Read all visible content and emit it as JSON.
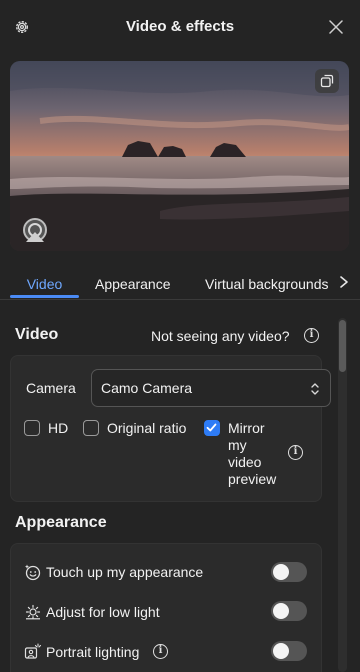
{
  "window": {
    "title": "Video & effects"
  },
  "preview": {
    "popout_icon": "popout-icon",
    "camera_badge": "camo-badge-icon"
  },
  "tabs": [
    {
      "label": "Video",
      "active": true
    },
    {
      "label": "Appearance",
      "active": false
    },
    {
      "label": "Virtual backgrounds",
      "active": false
    }
  ],
  "video_section": {
    "title": "Video",
    "hint": "Not seeing any video?",
    "camera_label": "Camera",
    "camera_value": "Camo Camera",
    "checkboxes": [
      {
        "label": "HD",
        "checked": false
      },
      {
        "label": "Original ratio",
        "checked": false
      },
      {
        "label_lines": [
          "Mirror",
          "my",
          "video",
          "preview"
        ],
        "checked": true
      }
    ]
  },
  "appearance_section": {
    "title": "Appearance",
    "rows": [
      {
        "label": "Touch up my appearance",
        "icon": "face-sparkle-icon",
        "on": false
      },
      {
        "label": "Adjust for low light",
        "icon": "sun-icon",
        "on": false
      },
      {
        "label": "Portrait lighting",
        "icon": "portrait-light-icon",
        "on": false,
        "has_info": true
      }
    ]
  },
  "colors": {
    "accent": "#4b8bf5",
    "background": "#242424",
    "card": "#2b2b2b"
  }
}
